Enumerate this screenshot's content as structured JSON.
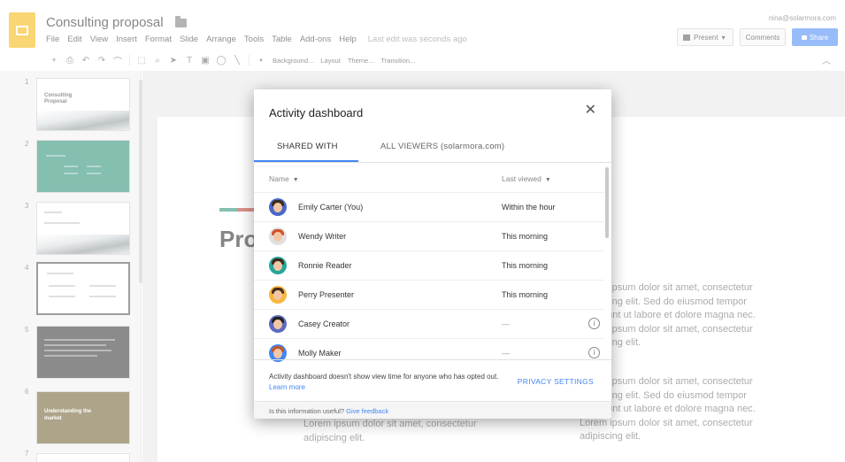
{
  "app": {
    "doc_title": "Consulting proposal",
    "account_email": "nina@solarmora.com",
    "menu": [
      "File",
      "Edit",
      "View",
      "Insert",
      "Format",
      "Slide",
      "Arrange",
      "Tools",
      "Table",
      "Add-ons",
      "Help"
    ],
    "last_edit": "Last edit was seconds ago",
    "present_label": "Present",
    "comments_label": "Comments",
    "share_label": "Share"
  },
  "toolbar": {
    "background": "Background...",
    "layout": "Layout",
    "theme": "Theme...",
    "transition": "Transition..."
  },
  "filmstrip": {
    "slides": [
      {
        "num": "1",
        "title": "Consulting Proposal"
      },
      {
        "num": "2"
      },
      {
        "num": "3"
      },
      {
        "num": "4"
      },
      {
        "num": "5"
      },
      {
        "num": "6",
        "title": "Understanding the market"
      },
      {
        "num": "7"
      }
    ]
  },
  "slide": {
    "title_peek": "Pro",
    "lorem_1": "Lorem ipsum dolor sit amet, consectetur adipiscing elit. Sed do eiusmod tempor incididunt ut labore et dolore magna nec. Lorem ipsum dolor sit amet, consectetur adipiscing elit.",
    "lorem_2": "Lorem ipsum dolor sit amet, consectetur adipiscing elit. Sed do eiusmod tempor incididunt ut labore et dolore magna nec. Lorem ipsum dolor sit amet, consectetur adipiscing elit.",
    "lorem_left": "Lorem ipsum dolor sit amet, consectetur adipiscing elit."
  },
  "dialog": {
    "title": "Activity dashboard",
    "tabs": [
      "SHARED WITH",
      "ALL VIEWERS (solarmora.com)"
    ],
    "columns": {
      "name": "Name",
      "last_viewed": "Last viewed"
    },
    "rows": [
      {
        "name": "Emily Carter (You)",
        "last_viewed": "Within the hour",
        "hair": "#3b2a1a",
        "bg": "#4a67c9"
      },
      {
        "name": "Wendy Writer",
        "last_viewed": "This morning",
        "hair": "#d1512d",
        "bg": "#e0e0e0"
      },
      {
        "name": "Ronnie Reader",
        "last_viewed": "This morning",
        "hair": "#3c2a1b",
        "bg": "#26a69a"
      },
      {
        "name": "Perry Presenter",
        "last_viewed": "This morning",
        "hair": "#4a2f1d",
        "bg": "#f6b73c"
      },
      {
        "name": "Casey Creator",
        "last_viewed": "—",
        "hair": "#222222",
        "bg": "#5c6bc0"
      },
      {
        "name": "Molly Maker",
        "last_viewed": "—",
        "hair": "#c0592d",
        "bg": "#4285f4"
      }
    ],
    "footnote": "Activity dashboard doesn't show view time for anyone who has opted out.",
    "learn_more": "Learn more",
    "privacy_settings": "PRIVACY SETTINGS",
    "feedback_question": "Is this information useful?",
    "feedback_link": "Give feedback"
  },
  "colors": {
    "accent": "#4285f4",
    "logo": "#f4b400"
  }
}
